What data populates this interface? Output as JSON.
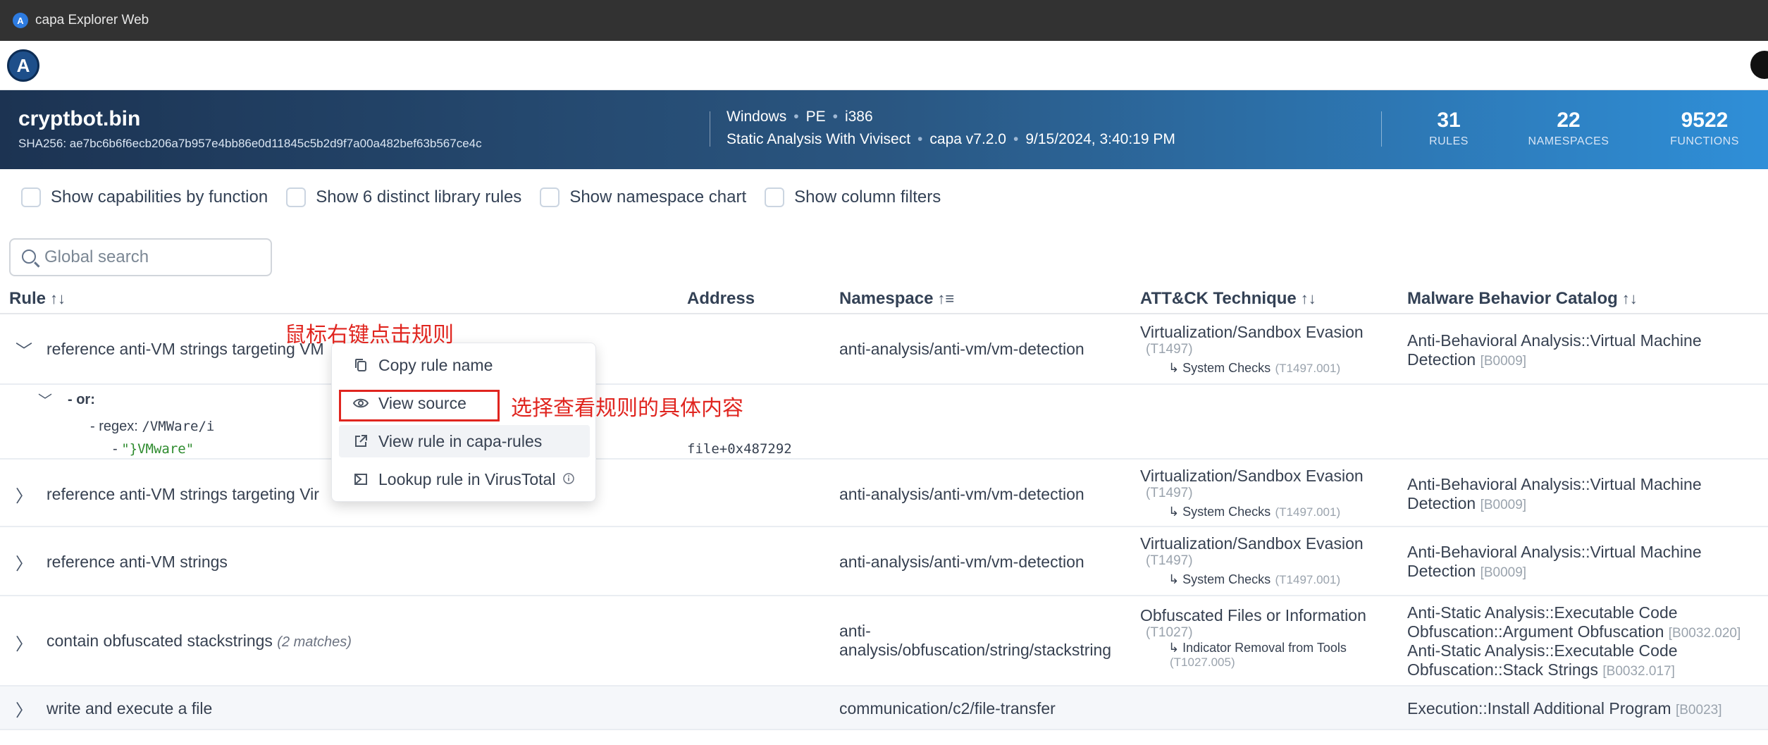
{
  "window": {
    "title": "capa Explorer Web"
  },
  "nav": {
    "logo_letter": "A"
  },
  "meta": {
    "filename": "cryptbot.bin",
    "sha256": "SHA256: ae7bc6b6f6ecb206a7b957e4bb86e0d11845c5b2d9f7a00a482bef63b567ce4c",
    "os": "Windows",
    "format": "PE",
    "arch": "i386",
    "analysis": "Static Analysis With Vivisect",
    "capa_version": "capa v7.2.0",
    "timestamp": "9/15/2024, 3:40:19 PM",
    "stats": [
      {
        "num": "31",
        "label": "RULES"
      },
      {
        "num": "22",
        "label": "NAMESPACES"
      },
      {
        "num": "9522",
        "label": "FUNCTIONS"
      }
    ]
  },
  "options": [
    "Show capabilities by function",
    "Show 6 distinct library rules",
    "Show namespace chart",
    "Show column filters"
  ],
  "search": {
    "placeholder": "Global search"
  },
  "table": {
    "headers": {
      "rule": "Rule",
      "address": "Address",
      "namespace": "Namespace",
      "attack": "ATT&CK Technique",
      "mbc": "Malware Behavior Catalog"
    },
    "rows": [
      {
        "rule": "reference anti-VM strings targeting VM",
        "namespace": "anti-analysis/anti-vm/vm-detection",
        "attack_name": "Virtualization/Sandbox Evasion",
        "attack_id": "(T1497)",
        "attack_sub": "↳ System Checks",
        "attack_sub_id": "(T1497.001)",
        "mbc_line1": "Anti-Behavioral Analysis::Virtual Machine",
        "mbc_line2": "Detection",
        "mbc_id": "[B0009]"
      },
      {
        "rule": "reference anti-VM strings targeting Vir",
        "namespace": "anti-analysis/anti-vm/vm-detection",
        "attack_name": "Virtualization/Sandbox Evasion",
        "attack_id": "(T1497)",
        "attack_sub": "↳ System Checks",
        "attack_sub_id": "(T1497.001)",
        "mbc_line1": "Anti-Behavioral Analysis::Virtual Machine",
        "mbc_line2": "Detection",
        "mbc_id": "[B0009]"
      },
      {
        "rule": "reference anti-VM strings",
        "namespace": "anti-analysis/anti-vm/vm-detection",
        "attack_name": "Virtualization/Sandbox Evasion",
        "attack_id": "(T1497)",
        "attack_sub": "↳ System Checks",
        "attack_sub_id": "(T1497.001)",
        "mbc_line1": "Anti-Behavioral Analysis::Virtual Machine",
        "mbc_line2": "Detection",
        "mbc_id": "[B0009]"
      },
      {
        "rule": "contain obfuscated stackstrings",
        "matches": "(2 matches)",
        "namespace_line1": "anti-",
        "namespace_line2": "analysis/obfuscation/string/stackstring",
        "attack_name": "Obfuscated Files or Information",
        "attack_id": "(T1027)",
        "attack_sub": "↳ Indicator Removal from Tools",
        "attack_sub_id": "(T1027.005)",
        "mbc_a1": "Anti-Static Analysis::Executable Code",
        "mbc_a2": "Obfuscation::Argument Obfuscation",
        "mbc_a_id": "[B0032.020]",
        "mbc_b1": "Anti-Static Analysis::Executable Code",
        "mbc_b2": "Obfuscation::Stack Strings",
        "mbc_b_id": "[B0032.017]"
      },
      {
        "rule": "write and execute a file",
        "namespace": "communication/c2/file-transfer",
        "mbc_line1": "Execution::Install Additional Program",
        "mbc_id": "[B0023]"
      }
    ],
    "expanded": {
      "or_label": "- or:",
      "regex_prefix": "- regex:",
      "regex_value": "/VMWare/i",
      "string_prefix": "-",
      "string_value": "\"}VMware\"",
      "address": "file+0x487292"
    }
  },
  "context_menu": {
    "items": [
      {
        "label": "Copy rule name",
        "icon": "copy-icon"
      },
      {
        "label": "View source",
        "icon": "eye-icon"
      },
      {
        "label": "View rule in capa-rules",
        "icon": "external-link-icon"
      },
      {
        "label": "Lookup rule in VirusTotal",
        "icon": "virustotal-icon"
      }
    ]
  },
  "annotations": {
    "right_click": "鼠标右键点击规则",
    "choose_view": "选择查看规则的具体内容"
  },
  "colors": {
    "annotation_red": "#e0251f",
    "banner_start": "#1c3352",
    "banner_end": "#2f8fd8"
  }
}
